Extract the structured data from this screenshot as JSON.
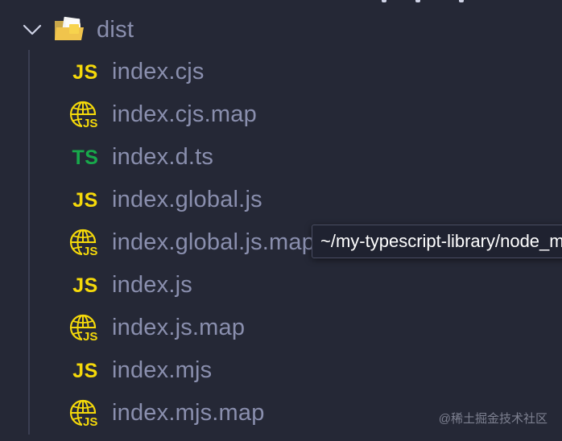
{
  "explorer": {
    "folder": {
      "name": "dist",
      "expanded": true,
      "icon": "folder-open-icon"
    },
    "files": [
      {
        "name": "index.cjs",
        "icon": "javascript-file-icon",
        "badge": "JS",
        "kind": "js"
      },
      {
        "name": "index.cjs.map",
        "icon": "sourcemap-file-icon",
        "badge": "JS",
        "kind": "map"
      },
      {
        "name": "index.d.ts",
        "icon": "typescript-file-icon",
        "badge": "TS",
        "kind": "ts"
      },
      {
        "name": "index.global.js",
        "icon": "javascript-file-icon",
        "badge": "JS",
        "kind": "js"
      },
      {
        "name": "index.global.js.map",
        "icon": "sourcemap-file-icon",
        "badge": "JS",
        "kind": "map"
      },
      {
        "name": "index.js",
        "icon": "javascript-file-icon",
        "badge": "JS",
        "kind": "js"
      },
      {
        "name": "index.js.map",
        "icon": "sourcemap-file-icon",
        "badge": "JS",
        "kind": "map"
      },
      {
        "name": "index.mjs",
        "icon": "javascript-file-icon",
        "badge": "JS",
        "kind": "js"
      },
      {
        "name": "index.mjs.map",
        "icon": "sourcemap-file-icon",
        "badge": "JS",
        "kind": "map"
      }
    ]
  },
  "tooltip": {
    "text": "~/my-typescript-library/node_modules/my-typescript-library/dist/index.global.js.map"
  },
  "watermark": {
    "text": "@稀土掘金技术社区"
  },
  "colors": {
    "background": "#252836",
    "label": "#8a8fae",
    "js_badge": "#f5d90a",
    "ts_badge": "#18a94b",
    "tooltip_bg": "#1f2230",
    "folder_yellow": "#f0c44c"
  }
}
